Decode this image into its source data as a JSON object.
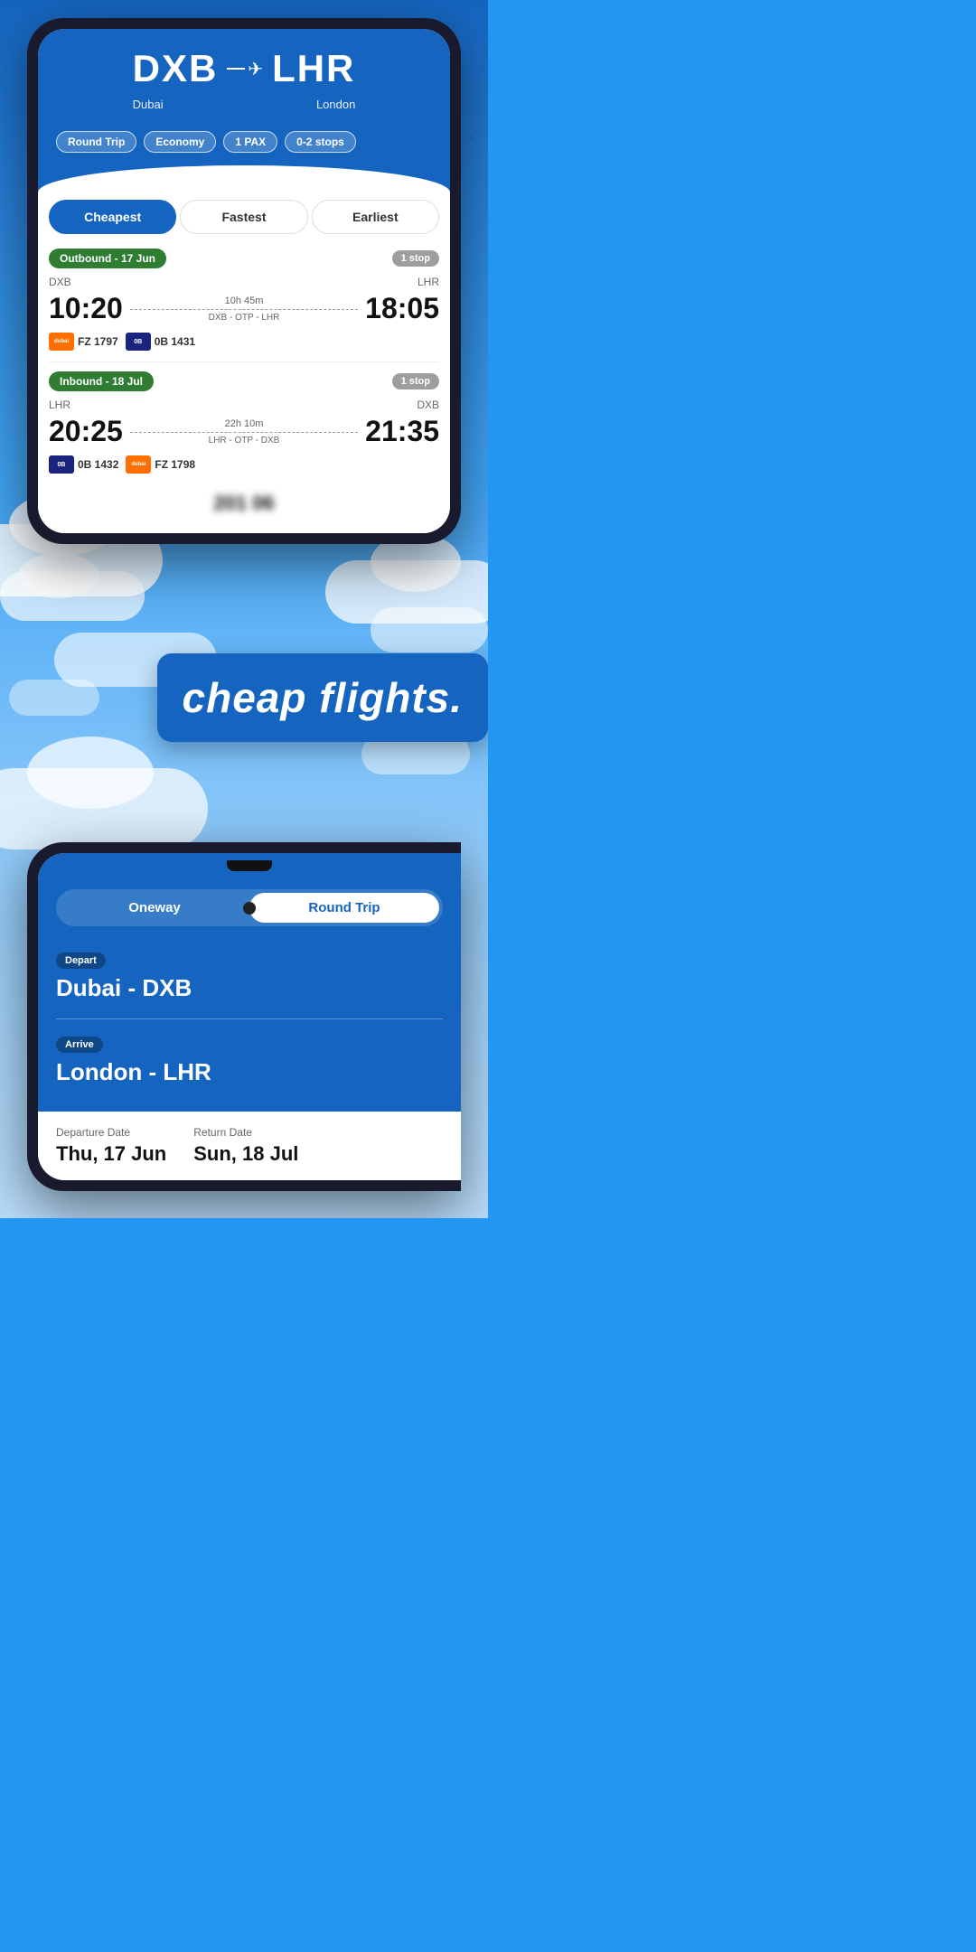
{
  "app": {
    "title": "cheap flights."
  },
  "phone1": {
    "route": {
      "origin_code": "DXB",
      "origin_city": "Dubai",
      "destination_code": "LHR",
      "destination_city": "London",
      "plane_symbol": "✈"
    },
    "filters": {
      "trip_type": "Round Trip",
      "cabin": "Economy",
      "pax": "1 PAX",
      "stops": "0-2 stops"
    },
    "tabs": [
      {
        "label": "Cheapest",
        "active": true
      },
      {
        "label": "Fastest",
        "active": false
      },
      {
        "label": "Earliest",
        "active": false
      }
    ],
    "outbound": {
      "label": "Outbound - 17 Jun",
      "stops_badge": "1 stop",
      "origin": "DXB",
      "destination": "LHR",
      "departure_time": "10:20",
      "arrival_time": "18:05",
      "duration": "10h 45m",
      "via": "DXB - OTP - LHR",
      "airlines": [
        {
          "code": "FZ 1797",
          "logo_text": "dubai",
          "color": "orange"
        },
        {
          "code": "0B 1431",
          "logo_text": "0B",
          "color": "blue"
        }
      ]
    },
    "inbound": {
      "label": "Inbound - 18 Jul",
      "stops_badge": "1 stop",
      "origin": "LHR",
      "destination": "DXB",
      "departure_time": "20:25",
      "arrival_time": "21:35",
      "duration": "22h 10m",
      "via": "LHR - OTP - DXB",
      "airlines": [
        {
          "code": "0B 1432",
          "logo_text": "0B",
          "color": "blue"
        },
        {
          "code": "FZ 1798",
          "logo_text": "dubai",
          "color": "orange"
        }
      ]
    },
    "price_peek": "201 06"
  },
  "phone2": {
    "toggle": {
      "option1": "Oneway",
      "option2": "Round Trip",
      "active": "Round Trip"
    },
    "depart": {
      "label": "Depart",
      "value": "Dubai - DXB"
    },
    "arrive": {
      "label": "Arrive",
      "value": "London - LHR"
    },
    "departure_date": {
      "label": "Departure Date",
      "value": "Thu, 17 Jun"
    },
    "return_date": {
      "label": "Return Date",
      "value": "Sun, 18 Jul"
    }
  }
}
